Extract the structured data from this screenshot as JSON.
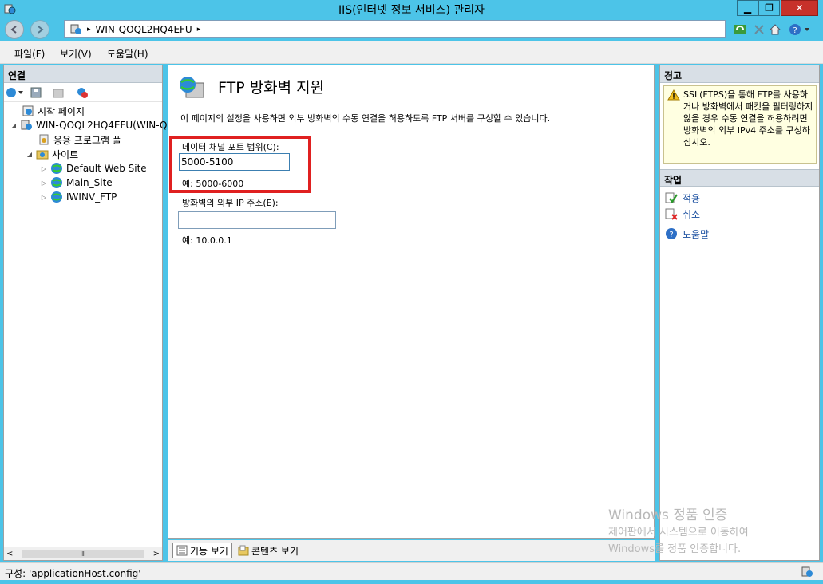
{
  "window": {
    "title": "IIS(인터넷 정보 서비스) 관리자",
    "min_glyph": "▁",
    "max_glyph": "❐",
    "close_glyph": "✕"
  },
  "address": {
    "path": "WIN-QOQL2HQ4EFU",
    "arrow_left": "▸",
    "arrow_right": "▸"
  },
  "menu": {
    "file": "파일(F)",
    "view": "보기(V)",
    "help": "도움말(H)"
  },
  "connections": {
    "header": "연결",
    "tree": [
      {
        "label": "시작 페이지"
      },
      {
        "label": "WIN-QOQL2HQ4EFU(WIN-Q"
      },
      {
        "label": "응용 프로그램 풀"
      },
      {
        "label": "사이트"
      },
      {
        "label": "Default Web Site"
      },
      {
        "label": "Main_Site"
      },
      {
        "label": "IWINV_FTP"
      }
    ],
    "scroll_thumb": "III",
    "scroll_left": "<",
    "scroll_right": ">"
  },
  "main": {
    "title": "FTP 방화벽 지원",
    "description": "이 페이지의 설정을 사용하면 외부 방화벽의 수동 연결을 허용하도록 FTP 서버를 구성할 수 있습니다.",
    "port_range_label": "데이터 채널 포트 범위(C):",
    "port_range_value": "5000-5100",
    "port_range_hint": "예: 5000-6000",
    "external_ip_label": "방화벽의 외부 IP 주소(E):",
    "external_ip_value": "",
    "external_ip_hint": "예: 10.0.0.1"
  },
  "bottom_tabs": {
    "features_view": "기능 보기",
    "content_view": "콘텐츠 보기"
  },
  "alerts": {
    "header": "경고",
    "message": "SSL(FTPS)을 통해 FTP를 사용하거나 방화벽에서 패킷을 필터링하지 않을 경우 수동 연결을 허용하려면 방화벽의 외부 IPv4 주소를 구성하십시오."
  },
  "actions": {
    "header": "작업",
    "apply": "적용",
    "cancel": "취소",
    "help": "도움말"
  },
  "watermark": {
    "line1": "Windows 정품 인증",
    "line2": "제어판에서 시스템으로 이동하여",
    "line3": "Windows를 정품 인증합니다."
  },
  "status": {
    "text": "구성: 'applicationHost.config'"
  },
  "colors": {
    "titlebar": "#4cc4e8",
    "highlight": "#e02020",
    "link": "#1a4fa0",
    "warning_bg": "#ffffe1"
  }
}
